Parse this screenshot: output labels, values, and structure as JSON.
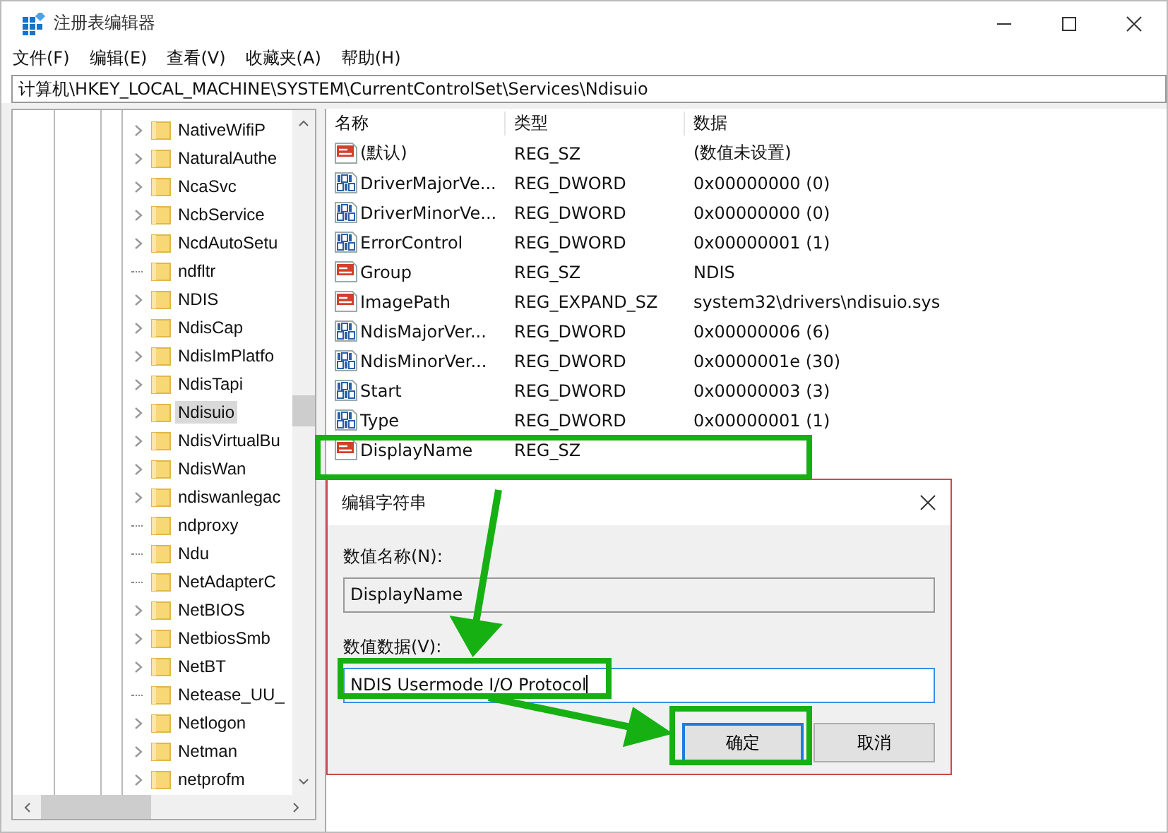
{
  "window": {
    "title": "注册表编辑器"
  },
  "menu": [
    "文件(F)",
    "编辑(E)",
    "查看(V)",
    "收藏夹(A)",
    "帮助(H)"
  ],
  "address": "计算机\\HKEY_LOCAL_MACHINE\\SYSTEM\\CurrentControlSet\\Services\\Ndisuio",
  "tree": [
    {
      "label": "NativeWifiP",
      "expandable": true,
      "selected": false
    },
    {
      "label": "NaturalAuthe",
      "expandable": true,
      "selected": false
    },
    {
      "label": "NcaSvc",
      "expandable": true,
      "selected": false
    },
    {
      "label": "NcbService",
      "expandable": true,
      "selected": false
    },
    {
      "label": "NcdAutoSetu",
      "expandable": true,
      "selected": false
    },
    {
      "label": "ndfltr",
      "expandable": false,
      "selected": false
    },
    {
      "label": "NDIS",
      "expandable": true,
      "selected": false
    },
    {
      "label": "NdisCap",
      "expandable": true,
      "selected": false
    },
    {
      "label": "NdisImPlatfo",
      "expandable": true,
      "selected": false
    },
    {
      "label": "NdisTapi",
      "expandable": true,
      "selected": false
    },
    {
      "label": "Ndisuio",
      "expandable": true,
      "selected": true
    },
    {
      "label": "NdisVirtualBu",
      "expandable": true,
      "selected": false
    },
    {
      "label": "NdisWan",
      "expandable": true,
      "selected": false
    },
    {
      "label": "ndiswanlegac",
      "expandable": true,
      "selected": false
    },
    {
      "label": "ndproxy",
      "expandable": false,
      "selected": false
    },
    {
      "label": "Ndu",
      "expandable": false,
      "selected": false
    },
    {
      "label": "NetAdapterC",
      "expandable": false,
      "selected": false
    },
    {
      "label": "NetBIOS",
      "expandable": true,
      "selected": false
    },
    {
      "label": "NetbiosSmb",
      "expandable": true,
      "selected": false
    },
    {
      "label": "NetBT",
      "expandable": true,
      "selected": false
    },
    {
      "label": "Netease_UU_",
      "expandable": false,
      "selected": false
    },
    {
      "label": "Netlogon",
      "expandable": true,
      "selected": false
    },
    {
      "label": "Netman",
      "expandable": true,
      "selected": false
    },
    {
      "label": "netprofm",
      "expandable": true,
      "selected": false
    }
  ],
  "table": {
    "columns": [
      "名称",
      "类型",
      "数据"
    ],
    "rows": [
      {
        "kind": "string",
        "name": "(默认)",
        "type": "REG_SZ",
        "data": "(数值未设置)"
      },
      {
        "kind": "number",
        "name": "DriverMajorVe...",
        "type": "REG_DWORD",
        "data": "0x00000000 (0)"
      },
      {
        "kind": "number",
        "name": "DriverMinorVe...",
        "type": "REG_DWORD",
        "data": "0x00000000 (0)"
      },
      {
        "kind": "number",
        "name": "ErrorControl",
        "type": "REG_DWORD",
        "data": "0x00000001 (1)"
      },
      {
        "kind": "string",
        "name": "Group",
        "type": "REG_SZ",
        "data": "NDIS"
      },
      {
        "kind": "string",
        "name": "ImagePath",
        "type": "REG_EXPAND_SZ",
        "data": "system32\\drivers\\ndisuio.sys"
      },
      {
        "kind": "number",
        "name": "NdisMajorVer...",
        "type": "REG_DWORD",
        "data": "0x00000006 (6)"
      },
      {
        "kind": "number",
        "name": "NdisMinorVer...",
        "type": "REG_DWORD",
        "data": "0x0000001e (30)"
      },
      {
        "kind": "number",
        "name": "Start",
        "type": "REG_DWORD",
        "data": "0x00000003 (3)"
      },
      {
        "kind": "number",
        "name": "Type",
        "type": "REG_DWORD",
        "data": "0x00000001 (1)"
      },
      {
        "kind": "string",
        "name": "DisplayName",
        "type": "REG_SZ"
      }
    ]
  },
  "dialog": {
    "title": "编辑字符串",
    "name_label": "数值名称(N):",
    "name_value": "DisplayName",
    "data_label": "数值数据(V):",
    "data_value": "NDIS Usermode I/O Protocol",
    "buttons": [
      "确定",
      "取消"
    ]
  }
}
